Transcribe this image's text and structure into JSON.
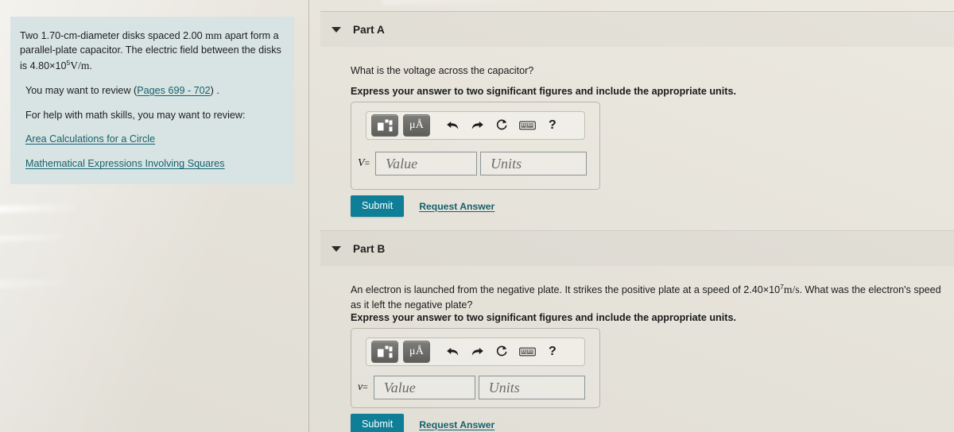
{
  "problem": {
    "statement_parts": {
      "a": "Two 1.70-cm-diameter disks spaced 2.00 ",
      "mm": "mm",
      "b": " apart form a parallel-plate capacitor. The electric field between the disks is 4.80×10",
      "exp": "5",
      "units": "V/m",
      "period": "."
    },
    "review_prefix": "You may want to review (",
    "review_link": "Pages 699 - 702",
    "review_suffix": ") .",
    "math_help_intro": "For help with math skills, you may want to review:",
    "links": [
      "Area Calculations for a Circle",
      "Mathematical Expressions Involving Squares"
    ]
  },
  "parts": [
    {
      "title": "Part A",
      "caret": "caret-down-icon",
      "question": "What is the voltage across the capacitor?",
      "instruction": "Express your answer to two significant figures and include the appropriate units.",
      "variable": "V",
      "equals": "=",
      "value_placeholder": "Value",
      "units_placeholder": "Units",
      "value": "",
      "units_value": "",
      "submit_label": "Submit",
      "request_label": "Request Answer"
    },
    {
      "title": "Part B",
      "caret": "caret-down-icon",
      "question_parts": {
        "a": "An electron is launched from the negative plate. It strikes the positive plate at a speed of 2.40×10",
        "exp": "7",
        "units": "m/s",
        "b": ". What was the electron's speed as it left the negative plate?"
      },
      "instruction": "Express your answer to two significant figures and include the appropriate units.",
      "variable": "v",
      "equals": "=",
      "value_placeholder": "Value",
      "units_placeholder": "Units",
      "value": "",
      "units_value": "",
      "submit_label": "Submit",
      "request_label": "Request Answer"
    }
  ],
  "toolbar": {
    "template_icon": "math-template-icon",
    "units_icon_label": "μÅ",
    "undo_icon": "undo-arrow-icon",
    "redo_icon": "redo-arrow-icon",
    "reset_icon": "reset-circular-arrow-icon",
    "keyboard_icon": "keyboard-icon",
    "help_label": "?"
  },
  "colors": {
    "accent_teal": "#0e7f96",
    "link_teal": "#15616d",
    "problem_card_bg": "#d8e4e4",
    "page_bg": "#e9e6df"
  }
}
